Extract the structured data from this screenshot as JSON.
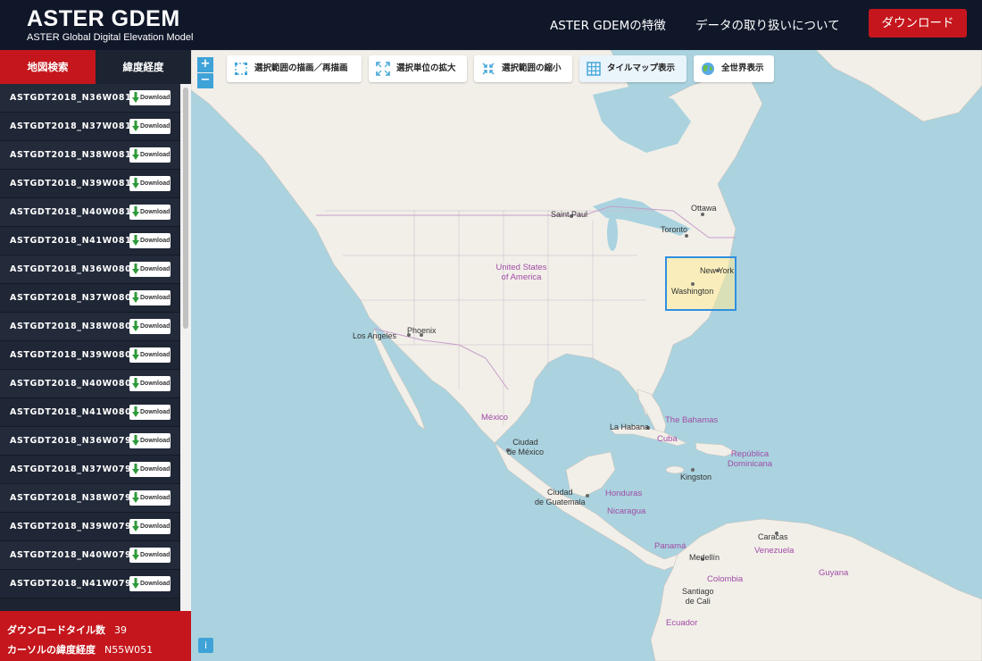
{
  "header": {
    "title": "ASTER GDEM",
    "subtitle": "ASTER Global Digital Elevation Model",
    "nav": [
      "ASTER GDEMの特徴",
      "データの取り扱いについて"
    ],
    "download_label": "ダウンロード"
  },
  "sidebar": {
    "tabs": [
      "地図検索",
      "緯度経度"
    ],
    "download_btn": "Download",
    "tiles": [
      "ASTGDT2018_N36W081",
      "ASTGDT2018_N37W081",
      "ASTGDT2018_N38W081",
      "ASTGDT2018_N39W081",
      "ASTGDT2018_N40W081",
      "ASTGDT2018_N41W081",
      "ASTGDT2018_N36W080",
      "ASTGDT2018_N37W080",
      "ASTGDT2018_N38W080",
      "ASTGDT2018_N39W080",
      "ASTGDT2018_N40W080",
      "ASTGDT2018_N41W080",
      "ASTGDT2018_N36W079",
      "ASTGDT2018_N37W079",
      "ASTGDT2018_N38W079",
      "ASTGDT2018_N39W079",
      "ASTGDT2018_N40W079",
      "ASTGDT2018_N41W079"
    ],
    "footer": {
      "count_label": "ダウンロードタイル数",
      "count_value": "39",
      "cursor_label": "カーソルの緯度経度",
      "cursor_value": "N55W051"
    }
  },
  "map": {
    "zoom_in": "+",
    "zoom_out": "−",
    "info": "i",
    "toolbar": [
      "選択範囲の描画／再描画",
      "選択単位の拡大",
      "選択範囲の縮小",
      "タイルマップ表示",
      "全世界表示"
    ],
    "cities": [
      "Ottawa",
      "Saint Paul",
      "Toronto",
      "New York",
      "Washington",
      "Los Angeles",
      "Phoenix",
      "La Habana",
      "Kingston",
      "Caracas",
      "Medellín"
    ],
    "cities_multiline": [
      [
        "Ciudad",
        "de México"
      ],
      [
        "Ciudad",
        "de Guatemala"
      ],
      [
        "Santiago",
        "de Cali"
      ]
    ],
    "countries": [
      "United States of America",
      "México",
      "The Bahamas",
      "Cuba",
      "República Dominicana",
      "Honduras",
      "Nicaragua",
      "Panamá",
      "Venezuela",
      "Colombia",
      "Guyana",
      "Ecuador"
    ]
  },
  "colors": {
    "brand_red": "#c4161c",
    "header_bg": "#0f1729",
    "sidebar_bg": "#1c2331",
    "accent_blue": "#3fa3d7",
    "water": "#aad3df",
    "land": "#f2efe9"
  }
}
